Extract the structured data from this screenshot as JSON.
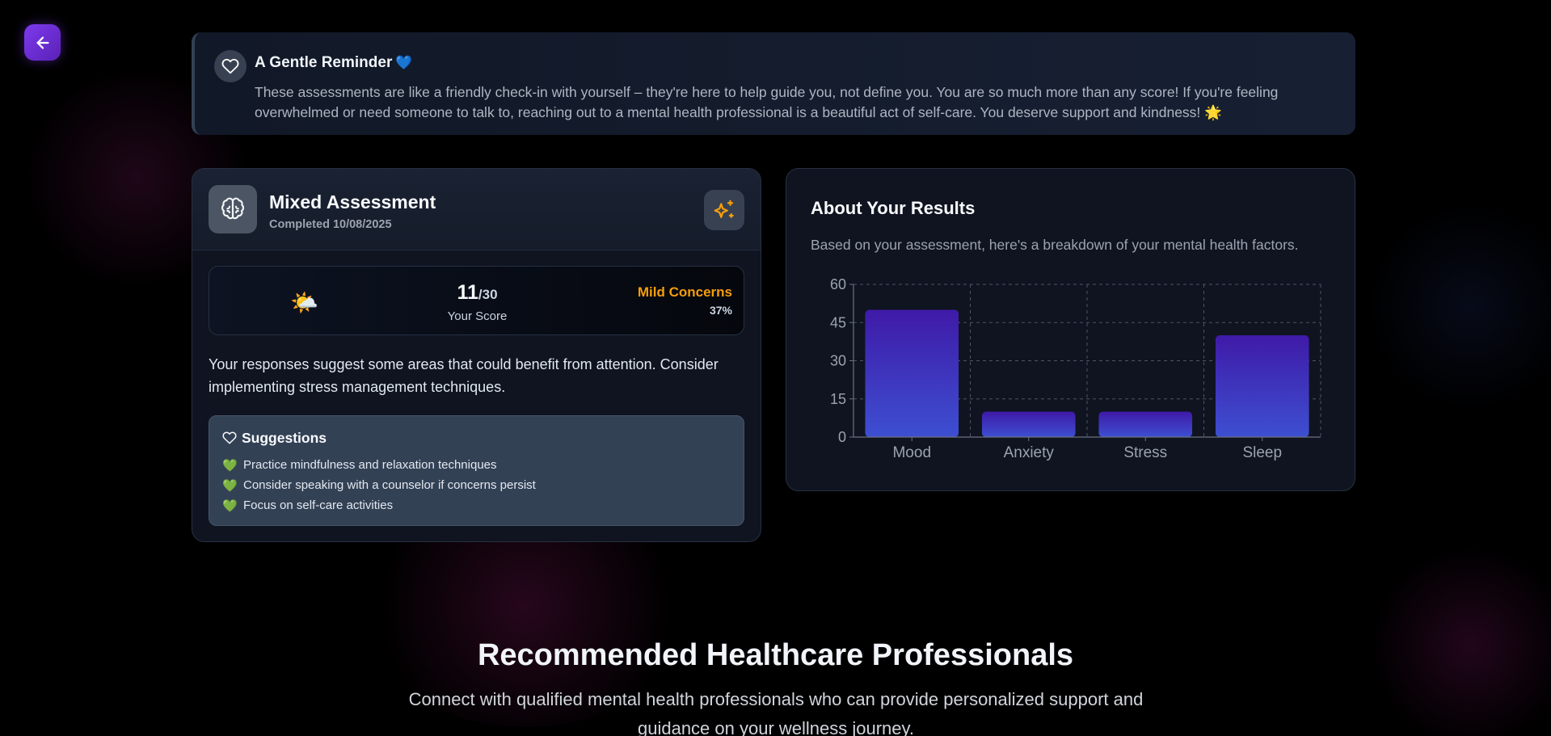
{
  "reminder": {
    "title": "A Gentle Reminder",
    "title_emoji": "💙",
    "body": "These assessments are like a friendly check-in with yourself – they're here to help guide you, not define you. You are so much more than any score! If you're feeling overwhelmed or need someone to talk to, reaching out to a mental health professional is a beautiful act of self-care. You deserve support and kindness! 🌟"
  },
  "assessment": {
    "title": "Mixed Assessment",
    "completed": "Completed 10/08/2025",
    "score_emoji": "🌤️",
    "score": "11",
    "score_total": "/30",
    "score_label": "Your Score",
    "concern_level": "Mild Concerns",
    "percent": "37%",
    "description": "Your responses suggest some areas that could benefit from attention. Consider implementing stress management techniques.",
    "suggestions_title": "Suggestions",
    "suggestion_bullet": "💚",
    "suggestions": [
      "Practice mindfulness and relaxation techniques",
      "Consider speaking with a counselor if concerns persist",
      "Focus on self-care activities"
    ]
  },
  "results": {
    "title": "About Your Results",
    "description": "Based on your assessment, here's a breakdown of your mental health factors."
  },
  "chart_data": {
    "type": "bar",
    "categories": [
      "Mood",
      "Anxiety",
      "Stress",
      "Sleep"
    ],
    "values": [
      50,
      10,
      10,
      40
    ],
    "ylim": [
      0,
      60
    ],
    "yticks": [
      0,
      15,
      30,
      45,
      60
    ],
    "grid": true,
    "title": "",
    "xlabel": "",
    "ylabel": "",
    "colors": {
      "bar_top": "#3f1aa8",
      "bar_bottom": "#3d4fd1",
      "grid": "#4b5563",
      "axis": "#6b7280",
      "tick_text": "#9ca3af"
    }
  },
  "recommendations": {
    "title": "Recommended Healthcare Professionals",
    "subtitle": "Connect with qualified mental health professionals who can provide personalized support and guidance on your wellness journey."
  },
  "colors": {
    "accent": "#7c3aed",
    "warning": "#f59e0b",
    "success": "#22c55e"
  },
  "icons": {
    "back": "arrow-left-icon",
    "reminder": "heart-icon",
    "assessment": "brain-icon",
    "sparkle": "sparkles-icon"
  }
}
